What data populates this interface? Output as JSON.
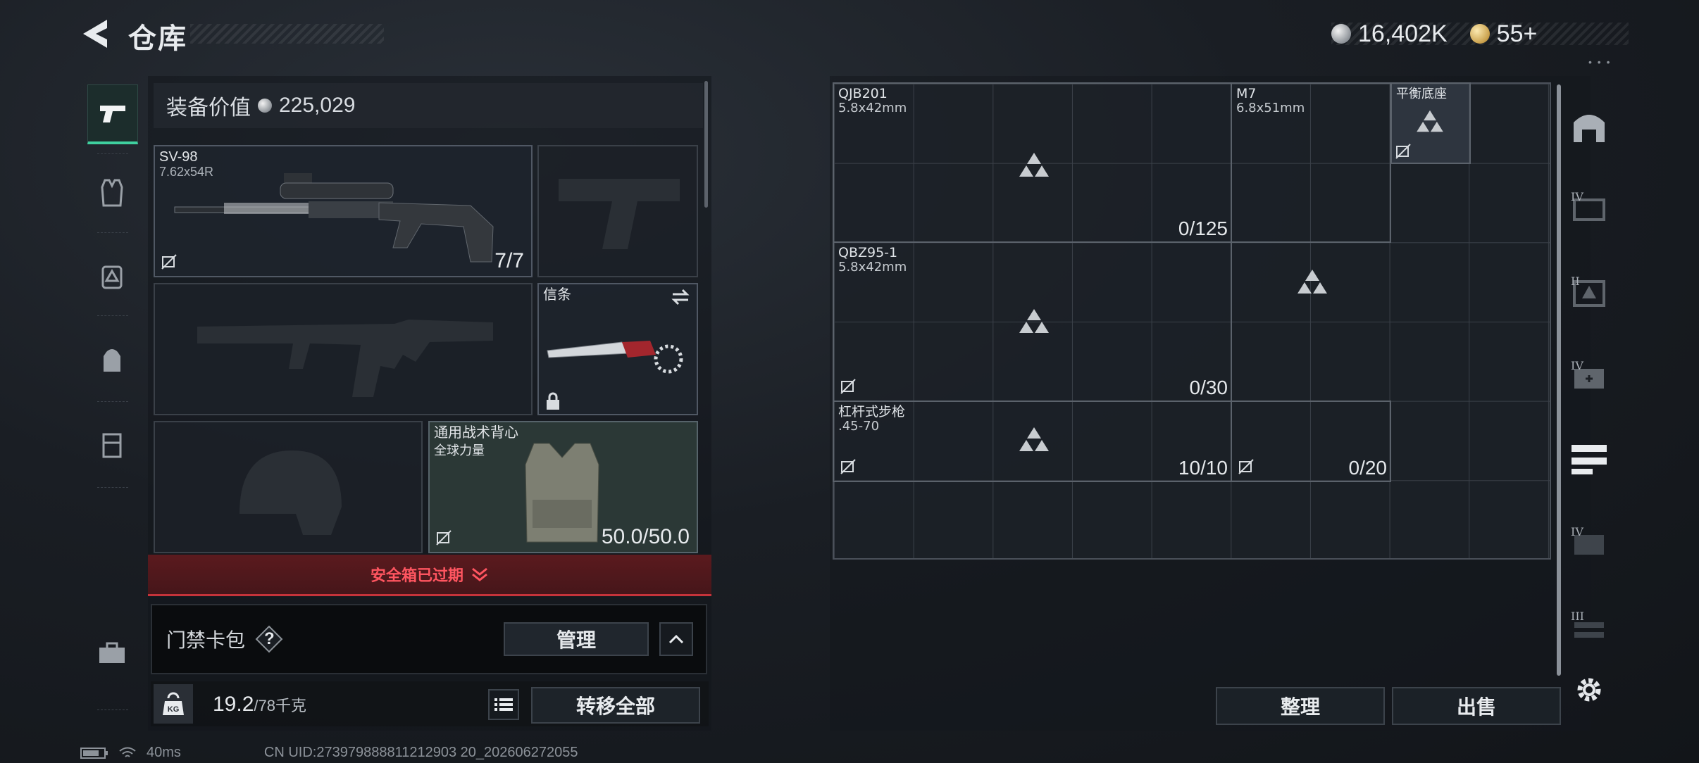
{
  "header": {
    "title": "仓库",
    "silver_amount": "16,402K",
    "gold_amount": "55+",
    "dots": "• • •"
  },
  "equipment": {
    "value_label": "装备价值",
    "value": "225,029",
    "primary": {
      "name": "SV-98",
      "ammo": "7.62x54R",
      "count": "7/7"
    },
    "melee": {
      "name": "信条"
    },
    "vest": {
      "name": "通用战术背心",
      "brand": "全球力量",
      "durability": "50.0/50.0"
    }
  },
  "safebox": {
    "label": "安全箱已过期"
  },
  "keycard": {
    "label": "门禁卡包",
    "help": "?",
    "manage_label": "管理"
  },
  "weight": {
    "icon_label": "KG",
    "current": "19.2",
    "max_unit": "/78千克",
    "transfer_label": "转移全部"
  },
  "storage": {
    "items": [
      {
        "name": "QJB201",
        "sub": "5.8x42mm",
        "count": "0/125"
      },
      {
        "name": "M7",
        "sub": "6.8x51mm",
        "count": ""
      },
      {
        "name": "平衡底座",
        "sub": "",
        "count": ""
      },
      {
        "name": "QBZ95-1",
        "sub": "5.8x42mm",
        "count": "0/30"
      },
      {
        "name": "杠杆式步枪",
        "sub": ".45-70",
        "count": "10/10"
      },
      {
        "name": "",
        "sub": "",
        "count": "0/20"
      }
    ],
    "sort_label": "整理",
    "sell_label": "出售"
  },
  "right_rail": {
    "levels": [
      "IV",
      "II",
      "IV",
      "IV",
      "III"
    ]
  },
  "status": {
    "ping": "40ms",
    "uid": "CN UID:273979888811212903 20_202606272055"
  }
}
